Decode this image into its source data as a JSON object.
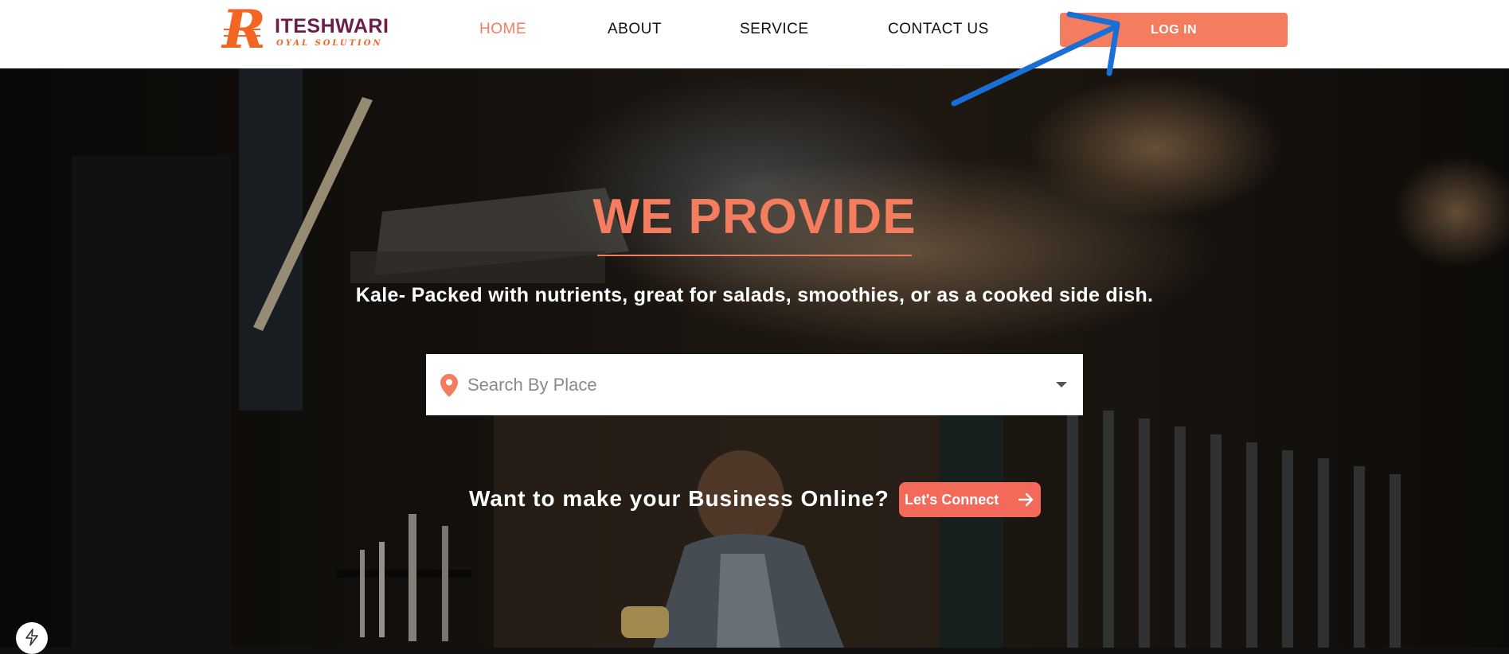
{
  "header": {
    "logo": {
      "letter": "R",
      "name": "ITESHWARI",
      "tagline": "OYAL SOLUTION"
    },
    "nav": [
      {
        "label": "HOME",
        "active": true
      },
      {
        "label": "ABOUT",
        "active": false
      },
      {
        "label": "SERVICE",
        "active": false
      },
      {
        "label": "CONTACT US",
        "active": false
      }
    ],
    "login_label": "LOG IN"
  },
  "hero": {
    "title": "WE PROVIDE",
    "subtitle": "Kale- Packed with nutrients, great for salads, smoothies, or as a cooked side dish.",
    "search": {
      "placeholder": "Search By Place",
      "icon": "map-pin-icon"
    },
    "cta_text": "Want to make your Business Online?",
    "cta_button": "Let's Connect",
    "cta_icon": "arrow-right-icon"
  },
  "floating_button": {
    "icon": "lightning-bolt-icon"
  },
  "colors": {
    "accent": "#f47c5f",
    "cta": "#f46a5a",
    "logo_orange": "#f26522",
    "logo_purple": "#6b1d4a",
    "annotation_arrow": "#1a6fd6"
  }
}
